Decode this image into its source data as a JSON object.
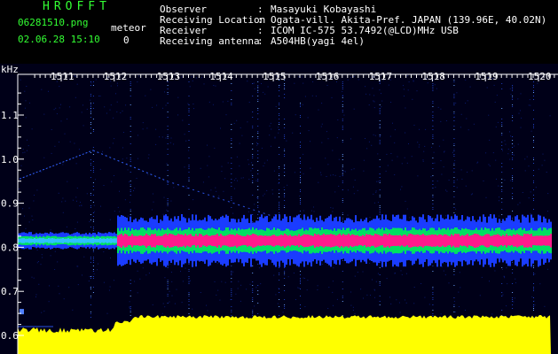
{
  "header": {
    "app_title": "HROFFT",
    "filename": "06281510.png",
    "datetime": "02.06.28 15:10",
    "meteor_label": "meteor",
    "meteor_count": "0",
    "info": [
      {
        "key": "Observer",
        "value": "Masayuki Kobayashi"
      },
      {
        "key": "Receiving Location",
        "value": "Ogata-vill. Akita-Pref. JAPAN (139.96E, 40.02N)"
      },
      {
        "key": "Receiver",
        "value": "ICOM IC-575 53.7492(@LCD)MHz USB"
      },
      {
        "key": "Receiving antenna",
        "value": "A504HB(yagi 4el)"
      }
    ]
  },
  "chart_data": {
    "type": "heatmap",
    "ylabel": "kHz",
    "y_ticks": [
      "1.1",
      "1.0",
      "0.9",
      "0.8",
      "0.7",
      "0.6"
    ],
    "x_ticks": [
      "1511",
      "1512",
      "1513",
      "1514",
      "1515",
      "1516",
      "1517",
      "1518",
      "1519",
      "1520"
    ],
    "ylim": [
      0.6,
      1.15
    ],
    "colors": {
      "background": "#000020",
      "strong": "#ff1a8c",
      "mid": "#00e060",
      "weak": "#1a3cff",
      "audio_envelope": "#ffff00"
    }
  }
}
